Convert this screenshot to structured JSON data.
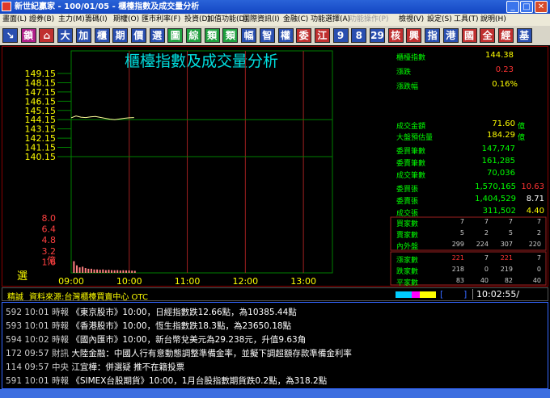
{
  "window": {
    "title": "新世紀贏家 - 100/01/05 - 櫃檯指數及成交量分析"
  },
  "menu": [
    "畫面(L)",
    "證券(B)",
    "主力(M)",
    "籌碼(I)",
    "期權(O)",
    "匯市利率(F)",
    "投資(D)",
    "加值功能(D)",
    "國際資訊(I)",
    "金融(C)",
    "功能選擇(A)",
    "功能操作(P)",
    "檢視(V)",
    "設定(S)",
    "工具(T)",
    "說明(H)"
  ],
  "toolbar": [
    {
      "label": "↘",
      "color": "#2a4fb0"
    },
    {
      "label": "鎖",
      "color": "#b0208a"
    },
    {
      "label": "⌂",
      "color": "#c03030"
    },
    {
      "label": "大",
      "color": "#2a4fb0"
    },
    {
      "label": "加",
      "color": "#2a4fb0"
    },
    {
      "label": "櫃",
      "color": "#2a4fb0"
    },
    {
      "label": "期",
      "color": "#2a4fb0"
    },
    {
      "label": "價",
      "color": "#2a4fb0"
    },
    {
      "label": "選",
      "color": "#2a4fb0"
    },
    {
      "label": "圖",
      "color": "#20a040"
    },
    {
      "label": "綜",
      "color": "#20a040"
    },
    {
      "label": "類",
      "color": "#20a040"
    },
    {
      "label": "類",
      "color": "#20a040"
    },
    {
      "label": "幅",
      "color": "#2a4fb0"
    },
    {
      "label": "智",
      "color": "#2a4fb0"
    },
    {
      "label": "權",
      "color": "#2a4fb0"
    },
    {
      "label": "委",
      "color": "#c03030"
    },
    {
      "label": "江",
      "color": "#c03030"
    },
    {
      "label": "9",
      "color": "#2a4fb0"
    },
    {
      "label": "8",
      "color": "#2a4fb0"
    },
    {
      "label": "29",
      "color": "#2a4fb0"
    },
    {
      "label": "核",
      "color": "#c03030"
    },
    {
      "label": "興",
      "color": "#c03030"
    },
    {
      "label": "指",
      "color": "#2a4fb0"
    },
    {
      "label": "港",
      "color": "#2a4fb0"
    },
    {
      "label": "國",
      "color": "#c03030"
    },
    {
      "label": "全",
      "color": "#c03030"
    },
    {
      "label": "經",
      "color": "#c03030"
    },
    {
      "label": "基",
      "color": "#2a4fb0"
    }
  ],
  "chart": {
    "title": "櫃檯指數及成交量分析",
    "selector_label": "選",
    "volume_unit": "億"
  },
  "chart_data": {
    "type": "line",
    "x_ticks": [
      "09:00",
      "10:00",
      "11:00",
      "12:00",
      "13:00"
    ],
    "x_range_minutes": [
      0,
      270
    ],
    "price_axis": {
      "ticks": [
        "149.15",
        "148.15",
        "147.15",
        "146.15",
        "145.15",
        "144.15",
        "143.15",
        "142.15",
        "141.15",
        "140.15"
      ],
      "range": [
        140.15,
        149.15
      ],
      "reference": 144.15
    },
    "volume_axis": {
      "ticks": [
        "8.0",
        "6.4",
        "4.8",
        "3.2",
        "1.6"
      ],
      "range": [
        0,
        8.0
      ]
    },
    "price_series": {
      "x": [
        0,
        5,
        10,
        15,
        20,
        25,
        30,
        35,
        40,
        45,
        50,
        55,
        60,
        65
      ],
      "y": [
        144.35,
        144.55,
        144.42,
        144.38,
        144.45,
        144.5,
        144.4,
        144.3,
        144.2,
        144.15,
        144.22,
        144.3,
        144.35,
        144.38
      ]
    },
    "volume_series": {
      "x": [
        2,
        5,
        8,
        11,
        14,
        17,
        20,
        23,
        26,
        29,
        32,
        35,
        38,
        41,
        44,
        47,
        50,
        53,
        56,
        59,
        62,
        65
      ],
      "y": [
        1.7,
        1.1,
        0.8,
        0.9,
        0.7,
        0.6,
        0.6,
        0.5,
        0.5,
        0.45,
        0.5,
        0.4,
        0.45,
        0.4,
        0.38,
        0.4,
        0.35,
        0.38,
        0.36,
        0.35,
        0.32,
        0.3
      ]
    }
  },
  "quote": {
    "index_label": "櫃檯指數",
    "index_value": "144.38",
    "change_label": "漲跌",
    "change_value": "0.23",
    "pct_label": "漲跌幅",
    "pct_value": "0.16%",
    "turnover_label": "成交金額",
    "turnover_value": "71.60",
    "turnover_unit": "億",
    "est_label": "大盤預估量",
    "est_value": "184.29",
    "est_unit": "億",
    "buy_orders_label": "委買筆數",
    "buy_orders_value": "147,747",
    "sell_orders_label": "委賣筆數",
    "sell_orders_value": "161,285",
    "trades_label": "成交筆數",
    "trades_value": "70,036",
    "bid_qty_label": "委買張",
    "bid_qty_value": "1,570,165",
    "bid_qty_avg": "10.63",
    "ask_qty_label": "委賣張",
    "ask_qty_value": "1,404,529",
    "ask_qty_avg": "8.71",
    "vol_label": "成交張",
    "vol_value": "311,502",
    "vol_avg": "4.40"
  },
  "breadth": [
    {
      "label": "買家數",
      "v": [
        "7",
        "7",
        "7",
        "7"
      ]
    },
    {
      "label": "賣家數",
      "v": [
        "5",
        "2",
        "5",
        "2"
      ]
    },
    {
      "label": "內外盤",
      "v": [
        "299",
        "224",
        "307",
        "220"
      ]
    },
    {
      "label": "漲家數",
      "v": [
        "221",
        "7",
        "221",
        "7"
      ]
    },
    {
      "label": "跌家數",
      "v": [
        "218",
        "0",
        "219",
        "0"
      ]
    },
    {
      "label": "平家數",
      "v": [
        "83",
        "40",
        "82",
        "40"
      ]
    }
  ],
  "status": {
    "tag": "精誠",
    "source": "資料來源:台灣櫃檯買賣中心 OTC",
    "clock": "10:02:55/"
  },
  "news": [
    {
      "num": "592",
      "time": "10:01",
      "src": "時報",
      "text": "《東京股市》10:00，日經指數跌12.66點，為10385.44點"
    },
    {
      "num": "593",
      "time": "10:01",
      "src": "時報",
      "text": "《香港股市》10:00，恆生指數跌18.3點，為23650.18點"
    },
    {
      "num": "594",
      "time": "10:02",
      "src": "時報",
      "text": "《國內匯市》10:00，新台幣兌美元為29.238元，升值9.63角"
    },
    {
      "num": "172",
      "time": "09:57",
      "src": "財訊",
      "text": "大陸金融：中國人行有意動態調整準備金率，並擬下調超額存款準備金利率"
    },
    {
      "num": "114",
      "time": "09:57",
      "src": "中央",
      "text": "江宜樺：併選疑 推不在籍投票"
    },
    {
      "num": "591",
      "time": "10:01",
      "src": "時報",
      "text": "《SIMEX台股期貨》10:00，1月台股指數期貨跌0.2點，為318.2點"
    }
  ],
  "colors": {
    "grid": "#008000",
    "price_line": "#ffff99",
    "volume_bar": "#ff8080",
    "axis_label": "#ffff00",
    "volume_label": "#ff4040",
    "title": "#00e0e0"
  }
}
